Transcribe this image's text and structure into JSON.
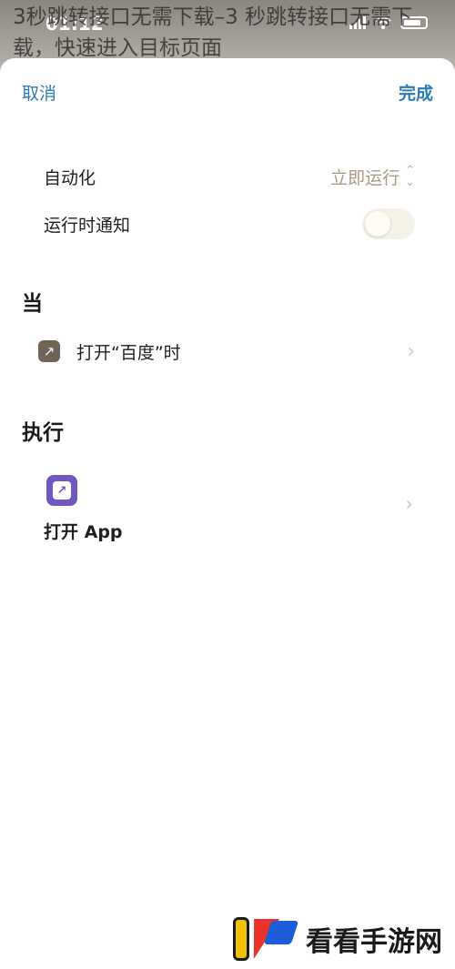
{
  "overlay_title": "3秒跳转接口无需下载–3 秒跳转接口无需下载，快速进入目标页面",
  "status_bar": {
    "time": "01:12"
  },
  "nav": {
    "cancel_label": "取消",
    "done_label": "完成"
  },
  "settings": [
    {
      "label": "自动化",
      "value": "立即运行"
    },
    {
      "label": "运行时通知",
      "toggle_on": false
    }
  ],
  "when_section": {
    "title": "当",
    "trigger": {
      "label": "打开“百度”时",
      "icon": "arrow-up-right-icon"
    }
  },
  "do_section": {
    "title": "执行",
    "action": {
      "label": "打开 App",
      "icon": "app-arrow-icon",
      "icon_color": "#7058c0"
    }
  },
  "colors": {
    "accent": "#2c7bb6",
    "value_text": "#a89a85"
  },
  "watermark": {
    "text": "看看手游网"
  }
}
